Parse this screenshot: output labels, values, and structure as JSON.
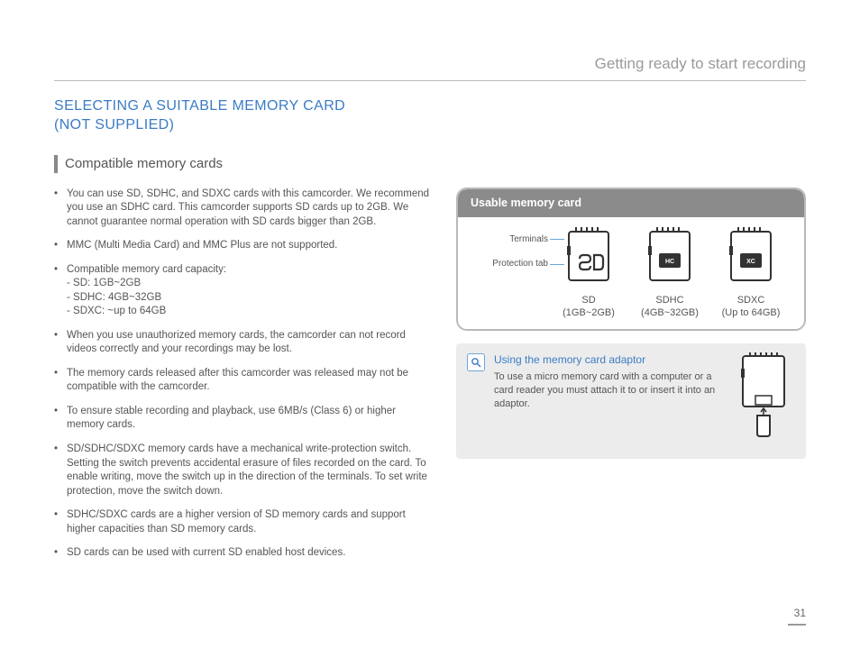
{
  "header": {
    "breadcrumb": "Getting ready to start recording"
  },
  "title": {
    "line1": "SELECTING A SUITABLE MEMORY CARD",
    "line2": "(NOT SUPPLIED)"
  },
  "section_heading": "Compatible memory cards",
  "bullets": [
    {
      "text": "You can use SD, SDHC, and SDXC cards with this camcorder. We recommend you use an SDHC card. This camcorder supports SD cards up to 2GB. We cannot guarantee normal operation with SD cards bigger than 2GB."
    },
    {
      "text": "MMC (Multi Media Card) and MMC Plus are not supported."
    },
    {
      "text": "Compatible memory card capacity:",
      "sublines": [
        "- SD: 1GB~2GB",
        "- SDHC: 4GB~32GB",
        "- SDXC: ~up to 64GB"
      ]
    },
    {
      "text": "When you use unauthorized memory cards, the camcorder can not record videos correctly and your recordings may be lost."
    },
    {
      "text": "The memory cards released after this camcorder was released may not be compatible with the camcorder."
    },
    {
      "text": "To ensure stable recording and playback, use 6MB/s (Class 6) or higher memory cards."
    },
    {
      "text": "SD/SDHC/SDXC memory cards have a mechanical write-protection switch. Setting the switch prevents accidental erasure of files recorded on the card. To enable writing, move the switch up in the direction of the terminals. To set write protection, move the switch down."
    },
    {
      "text": "SDHC/SDXC cards are a higher version of SD memory cards and support higher capacities than SD memory cards."
    },
    {
      "text": "SD cards can be used with current SD enabled host devices."
    }
  ],
  "usable": {
    "header": "Usable memory card",
    "pointer_labels": {
      "terminals": "Terminals",
      "protection_tab": "Protection tab"
    },
    "cards": [
      {
        "name": "SD",
        "capacity": "(1GB~2GB)",
        "logo": "sd"
      },
      {
        "name": "SDHC",
        "capacity": "(4GB~32GB)",
        "logo": "sdhc"
      },
      {
        "name": "SDXC",
        "capacity": "(Up to 64GB)",
        "logo": "sdxc"
      }
    ]
  },
  "adaptor": {
    "title": "Using the memory card adaptor",
    "body": "To use a micro memory card with a computer or a card reader you must attach it to or insert it into an adaptor."
  },
  "page_number": "31"
}
